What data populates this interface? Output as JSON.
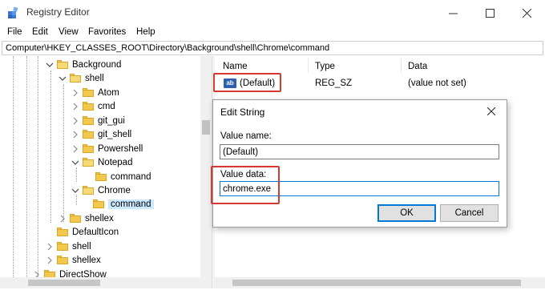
{
  "window": {
    "title": "Registry Editor"
  },
  "menu": [
    "File",
    "Edit",
    "View",
    "Favorites",
    "Help"
  ],
  "address": "Computer\\HKEY_CLASSES_ROOT\\Directory\\Background\\shell\\Chrome\\command",
  "tree": [
    {
      "label": "Background",
      "expanded": true
    },
    {
      "label": "shell",
      "expanded": true
    },
    {
      "label": "Atom",
      "expanded": false
    },
    {
      "label": "cmd",
      "expanded": false
    },
    {
      "label": "git_gui",
      "expanded": false
    },
    {
      "label": "git_shell",
      "expanded": false
    },
    {
      "label": "Powershell",
      "expanded": false
    },
    {
      "label": "Notepad",
      "expanded": true
    },
    {
      "label": "command",
      "expanded": false
    },
    {
      "label": "Chrome",
      "expanded": true
    },
    {
      "label": "command",
      "expanded": false,
      "selected": true
    },
    {
      "label": "shellex",
      "expanded": false
    },
    {
      "label": "DefaultIcon",
      "expanded": false
    },
    {
      "label": "shell",
      "expanded": false
    },
    {
      "label": "shellex",
      "expanded": false
    },
    {
      "label": "DirectShow",
      "expanded": false
    }
  ],
  "list": {
    "columns": [
      "Name",
      "Type",
      "Data"
    ],
    "rows": [
      {
        "icon": "string-value-icon",
        "icon_text": "ab",
        "name": "(Default)",
        "type": "REG_SZ",
        "data": "(value not set)"
      }
    ]
  },
  "dialog": {
    "title": "Edit String",
    "value_name_label": "Value name:",
    "value_name": "(Default)",
    "value_data_label": "Value data:",
    "value_data": "chrome.exe",
    "ok_label": "OK",
    "cancel_label": "Cancel"
  },
  "colors": {
    "annotation": "#d63a2f",
    "selection": "#cce8ff",
    "folder": "#f2c94c",
    "focus": "#0078d7"
  }
}
